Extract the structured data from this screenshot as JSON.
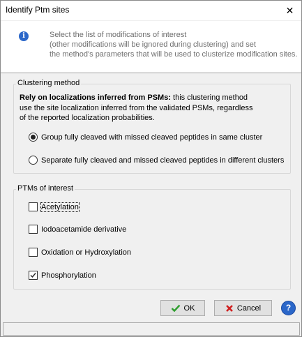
{
  "window": {
    "title": "Identify Ptm sites",
    "close_glyph": "✕"
  },
  "banner": {
    "icon": "info-icon",
    "icon_glyph": "i",
    "lines": [
      "Select the list of modifications of interest",
      "(other modifications will be ignored during clustering) and set",
      "the method's parameters that will be used to clusterize modification sites."
    ]
  },
  "clustering": {
    "group_title": "Clustering method",
    "heading_bold": "Rely on localizations inferred from PSMs:",
    "heading_rest": " this clustering method",
    "desc_lines": [
      "use the site localization inferred from the validated PSMs, regardless",
      "of the reported localization probabilities."
    ],
    "options": [
      {
        "label": "Group fully cleaved with missed cleaved peptides in same cluster",
        "selected": true
      },
      {
        "label": "Separate fully cleaved and missed cleaved peptides in different clusters",
        "selected": false
      }
    ]
  },
  "ptms": {
    "group_title": "PTMs of interest",
    "items": [
      {
        "label": "Acetylation",
        "checked": false
      },
      {
        "label": "Iodoacetamide derivative",
        "checked": false
      },
      {
        "label": "Oxidation or Hydroxylation",
        "checked": false
      },
      {
        "label": "Phosphorylation",
        "checked": true
      }
    ]
  },
  "buttons": {
    "ok": "OK",
    "cancel": "Cancel",
    "help_glyph": "?",
    "colors": {
      "ok_check": "#2e9e2e",
      "cancel_x": "#d02020",
      "help": "#2b67c9"
    }
  }
}
